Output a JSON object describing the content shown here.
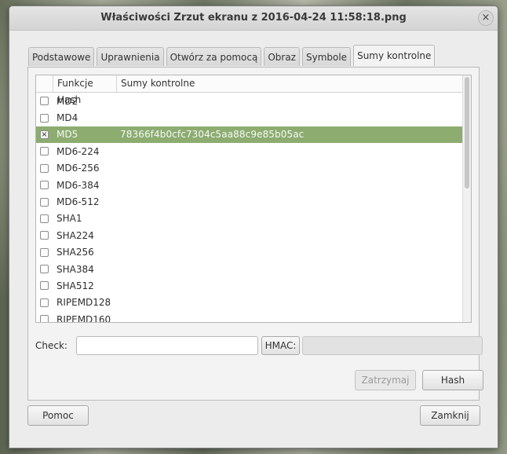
{
  "window": {
    "title": "Właściwości Zrzut ekranu z 2016-04-24 11:58:18.png",
    "close_glyph": "×"
  },
  "tabs": [
    {
      "label": "Podstawowe"
    },
    {
      "label": "Uprawnienia"
    },
    {
      "label": "Otwórz za pomocą"
    },
    {
      "label": "Obraz"
    },
    {
      "label": "Symbole"
    },
    {
      "label": "Sumy kontrolne",
      "active": true
    }
  ],
  "list": {
    "columns": [
      "Funkcje Hash",
      "Sumy kontrolne"
    ],
    "rows": [
      {
        "name": "MD2",
        "checked": false,
        "sum": ""
      },
      {
        "name": "MD4",
        "checked": false,
        "sum": ""
      },
      {
        "name": "MD5",
        "checked": true,
        "sum": "78366f4b0cfc7304c5aa88c9e85b05ac"
      },
      {
        "name": "MD6-224",
        "checked": false,
        "sum": ""
      },
      {
        "name": "MD6-256",
        "checked": false,
        "sum": ""
      },
      {
        "name": "MD6-384",
        "checked": false,
        "sum": ""
      },
      {
        "name": "MD6-512",
        "checked": false,
        "sum": ""
      },
      {
        "name": "SHA1",
        "checked": false,
        "sum": ""
      },
      {
        "name": "SHA224",
        "checked": false,
        "sum": ""
      },
      {
        "name": "SHA256",
        "checked": false,
        "sum": ""
      },
      {
        "name": "SHA384",
        "checked": false,
        "sum": ""
      },
      {
        "name": "SHA512",
        "checked": false,
        "sum": ""
      },
      {
        "name": "RIPEMD128",
        "checked": false,
        "sum": ""
      },
      {
        "name": "RIPEMD160",
        "checked": false,
        "sum": ""
      }
    ],
    "check_glyph": "×"
  },
  "check": {
    "label": "Check:",
    "value": "",
    "hmac_label": "HMAC:",
    "hmac_value": ""
  },
  "actions": {
    "stop_label": "Zatrzymaj",
    "hash_label": "Hash"
  },
  "footer": {
    "help_label": "Pomoc",
    "close_label": "Zamknij"
  },
  "colors": {
    "selected_row": "#8cac70"
  }
}
